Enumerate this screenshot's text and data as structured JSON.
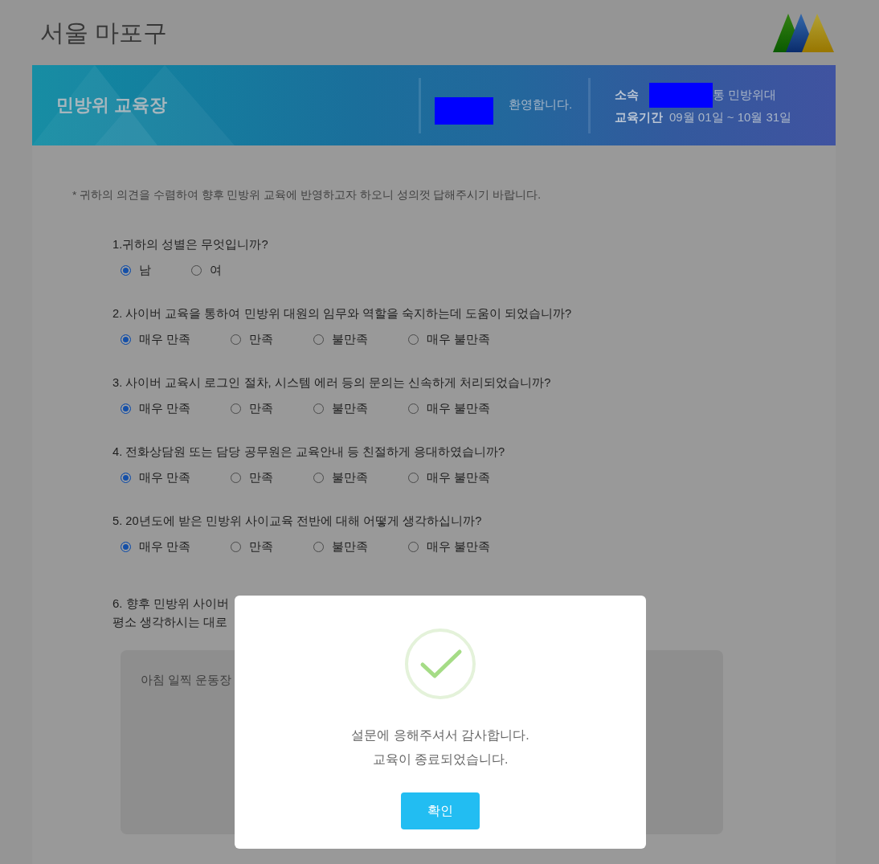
{
  "header": {
    "title": "서울 마포구"
  },
  "banner": {
    "title": "민방위 교육장",
    "welcome": "환영합니다.",
    "affiliation_label": "소속",
    "affiliation_value": "통 민방위대",
    "period_label": "교육기간",
    "period_value": "09월 01일 ~ 10월 31일"
  },
  "survey": {
    "notice": "* 귀하의 의견을 수렴하여 향후 민방위 교육에 반영하고자 하오니 성의껏 답해주시기 바랍니다.",
    "questions": [
      {
        "kind": "choice",
        "text": "1.귀하의 성별은 무엇입니까?",
        "options": [
          {
            "label": "남",
            "selected": true
          },
          {
            "label": "여",
            "selected": false
          }
        ]
      },
      {
        "kind": "choice",
        "text": "2. 사이버 교육을 통하여 민방위 대원의 임무와 역할을 숙지하는데 도움이 되었습니까?",
        "options": [
          {
            "label": "매우 만족",
            "selected": true
          },
          {
            "label": "만족",
            "selected": false
          },
          {
            "label": "불만족",
            "selected": false
          },
          {
            "label": "매우 불만족",
            "selected": false
          }
        ]
      },
      {
        "kind": "choice",
        "text": "3. 사이버 교육시 로그인 절차, 시스템 에러 등의 문의는 신속하게 처리되었습니까?",
        "options": [
          {
            "label": "매우 만족",
            "selected": true
          },
          {
            "label": "만족",
            "selected": false
          },
          {
            "label": "불만족",
            "selected": false
          },
          {
            "label": "매우 불만족",
            "selected": false
          }
        ]
      },
      {
        "kind": "choice",
        "text": "4. 전화상담원 또는 담당 공무원은 교육안내 등 친절하게 응대하였습니까?",
        "options": [
          {
            "label": "매우 만족",
            "selected": true
          },
          {
            "label": "만족",
            "selected": false
          },
          {
            "label": "불만족",
            "selected": false
          },
          {
            "label": "매우 불만족",
            "selected": false
          }
        ]
      },
      {
        "kind": "choice",
        "text": "5. 20년도에 받은 민방위 사이교육 전반에 대해 어떻게 생각하십니까?",
        "options": [
          {
            "label": "매우 만족",
            "selected": true
          },
          {
            "label": "만족",
            "selected": false
          },
          {
            "label": "불만족",
            "selected": false
          },
          {
            "label": "매우 불만족",
            "selected": false
          }
        ]
      },
      {
        "kind": "text",
        "lines": [
          "6. 향후 민방위 사이버",
          "평소 생각하시는 대로"
        ],
        "value": "아침 일찍 운동장"
      }
    ]
  },
  "dialog": {
    "messages": [
      "설문에 응해주셔서 감사합니다.",
      "교육이 종료되었습니다."
    ],
    "button": "확인"
  }
}
